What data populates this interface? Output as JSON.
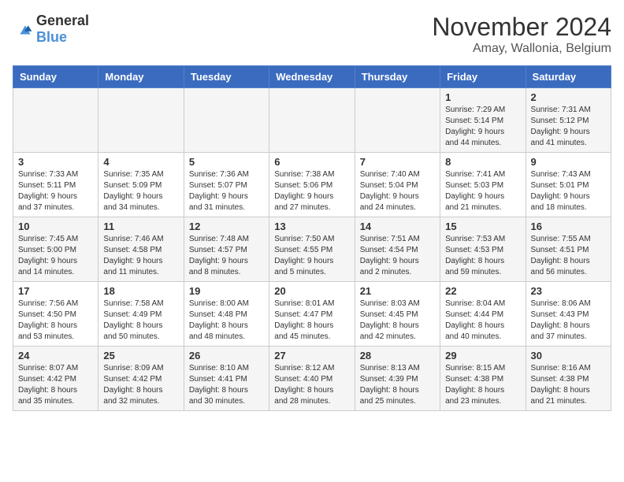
{
  "logo": {
    "general": "General",
    "blue": "Blue"
  },
  "title": "November 2024",
  "location": "Amay, Wallonia, Belgium",
  "weekdays": [
    "Sunday",
    "Monday",
    "Tuesday",
    "Wednesday",
    "Thursday",
    "Friday",
    "Saturday"
  ],
  "weeks": [
    [
      {
        "day": "",
        "info": ""
      },
      {
        "day": "",
        "info": ""
      },
      {
        "day": "",
        "info": ""
      },
      {
        "day": "",
        "info": ""
      },
      {
        "day": "",
        "info": ""
      },
      {
        "day": "1",
        "info": "Sunrise: 7:29 AM\nSunset: 5:14 PM\nDaylight: 9 hours\nand 44 minutes."
      },
      {
        "day": "2",
        "info": "Sunrise: 7:31 AM\nSunset: 5:12 PM\nDaylight: 9 hours\nand 41 minutes."
      }
    ],
    [
      {
        "day": "3",
        "info": "Sunrise: 7:33 AM\nSunset: 5:11 PM\nDaylight: 9 hours\nand 37 minutes."
      },
      {
        "day": "4",
        "info": "Sunrise: 7:35 AM\nSunset: 5:09 PM\nDaylight: 9 hours\nand 34 minutes."
      },
      {
        "day": "5",
        "info": "Sunrise: 7:36 AM\nSunset: 5:07 PM\nDaylight: 9 hours\nand 31 minutes."
      },
      {
        "day": "6",
        "info": "Sunrise: 7:38 AM\nSunset: 5:06 PM\nDaylight: 9 hours\nand 27 minutes."
      },
      {
        "day": "7",
        "info": "Sunrise: 7:40 AM\nSunset: 5:04 PM\nDaylight: 9 hours\nand 24 minutes."
      },
      {
        "day": "8",
        "info": "Sunrise: 7:41 AM\nSunset: 5:03 PM\nDaylight: 9 hours\nand 21 minutes."
      },
      {
        "day": "9",
        "info": "Sunrise: 7:43 AM\nSunset: 5:01 PM\nDaylight: 9 hours\nand 18 minutes."
      }
    ],
    [
      {
        "day": "10",
        "info": "Sunrise: 7:45 AM\nSunset: 5:00 PM\nDaylight: 9 hours\nand 14 minutes."
      },
      {
        "day": "11",
        "info": "Sunrise: 7:46 AM\nSunset: 4:58 PM\nDaylight: 9 hours\nand 11 minutes."
      },
      {
        "day": "12",
        "info": "Sunrise: 7:48 AM\nSunset: 4:57 PM\nDaylight: 9 hours\nand 8 minutes."
      },
      {
        "day": "13",
        "info": "Sunrise: 7:50 AM\nSunset: 4:55 PM\nDaylight: 9 hours\nand 5 minutes."
      },
      {
        "day": "14",
        "info": "Sunrise: 7:51 AM\nSunset: 4:54 PM\nDaylight: 9 hours\nand 2 minutes."
      },
      {
        "day": "15",
        "info": "Sunrise: 7:53 AM\nSunset: 4:53 PM\nDaylight: 8 hours\nand 59 minutes."
      },
      {
        "day": "16",
        "info": "Sunrise: 7:55 AM\nSunset: 4:51 PM\nDaylight: 8 hours\nand 56 minutes."
      }
    ],
    [
      {
        "day": "17",
        "info": "Sunrise: 7:56 AM\nSunset: 4:50 PM\nDaylight: 8 hours\nand 53 minutes."
      },
      {
        "day": "18",
        "info": "Sunrise: 7:58 AM\nSunset: 4:49 PM\nDaylight: 8 hours\nand 50 minutes."
      },
      {
        "day": "19",
        "info": "Sunrise: 8:00 AM\nSunset: 4:48 PM\nDaylight: 8 hours\nand 48 minutes."
      },
      {
        "day": "20",
        "info": "Sunrise: 8:01 AM\nSunset: 4:47 PM\nDaylight: 8 hours\nand 45 minutes."
      },
      {
        "day": "21",
        "info": "Sunrise: 8:03 AM\nSunset: 4:45 PM\nDaylight: 8 hours\nand 42 minutes."
      },
      {
        "day": "22",
        "info": "Sunrise: 8:04 AM\nSunset: 4:44 PM\nDaylight: 8 hours\nand 40 minutes."
      },
      {
        "day": "23",
        "info": "Sunrise: 8:06 AM\nSunset: 4:43 PM\nDaylight: 8 hours\nand 37 minutes."
      }
    ],
    [
      {
        "day": "24",
        "info": "Sunrise: 8:07 AM\nSunset: 4:42 PM\nDaylight: 8 hours\nand 35 minutes."
      },
      {
        "day": "25",
        "info": "Sunrise: 8:09 AM\nSunset: 4:42 PM\nDaylight: 8 hours\nand 32 minutes."
      },
      {
        "day": "26",
        "info": "Sunrise: 8:10 AM\nSunset: 4:41 PM\nDaylight: 8 hours\nand 30 minutes."
      },
      {
        "day": "27",
        "info": "Sunrise: 8:12 AM\nSunset: 4:40 PM\nDaylight: 8 hours\nand 28 minutes."
      },
      {
        "day": "28",
        "info": "Sunrise: 8:13 AM\nSunset: 4:39 PM\nDaylight: 8 hours\nand 25 minutes."
      },
      {
        "day": "29",
        "info": "Sunrise: 8:15 AM\nSunset: 4:38 PM\nDaylight: 8 hours\nand 23 minutes."
      },
      {
        "day": "30",
        "info": "Sunrise: 8:16 AM\nSunset: 4:38 PM\nDaylight: 8 hours\nand 21 minutes."
      }
    ]
  ]
}
